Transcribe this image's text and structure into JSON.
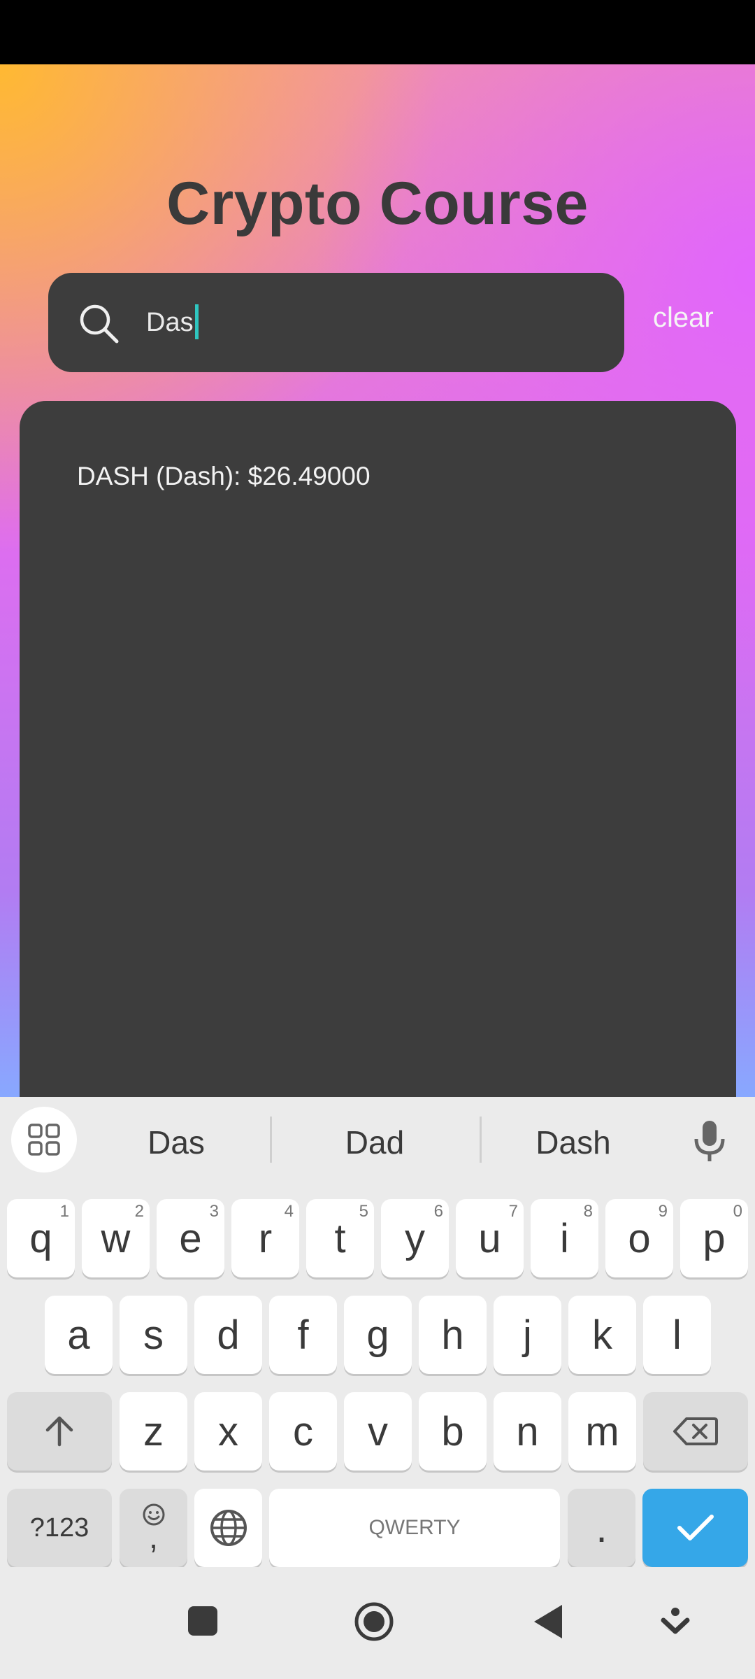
{
  "app": {
    "title": "Crypto Course",
    "search": {
      "value": "Das",
      "clear_label": "clear"
    },
    "results": [
      {
        "text": "DASH (Dash): $26.49000"
      }
    ]
  },
  "keyboard": {
    "suggestions": [
      "Das",
      "Dad",
      "Dash"
    ],
    "row1": [
      {
        "k": "q",
        "h": "1"
      },
      {
        "k": "w",
        "h": "2"
      },
      {
        "k": "e",
        "h": "3"
      },
      {
        "k": "r",
        "h": "4"
      },
      {
        "k": "t",
        "h": "5"
      },
      {
        "k": "y",
        "h": "6"
      },
      {
        "k": "u",
        "h": "7"
      },
      {
        "k": "i",
        "h": "8"
      },
      {
        "k": "o",
        "h": "9"
      },
      {
        "k": "p",
        "h": "0"
      }
    ],
    "row2": [
      "a",
      "s",
      "d",
      "f",
      "g",
      "h",
      "j",
      "k",
      "l"
    ],
    "row3": [
      "z",
      "x",
      "c",
      "v",
      "b",
      "n",
      "m"
    ],
    "symbols_label": "?123",
    "comma_label": ",",
    "space_label": "QWERTY",
    "period_label": "."
  },
  "colors": {
    "enter_key": "#35a7e8",
    "caret": "#2fc6c0",
    "card": "#3d3d3d"
  },
  "icons": [
    "search-icon",
    "apps-grid-icon",
    "microphone-icon",
    "shift-icon",
    "backspace-icon",
    "emoji-icon",
    "globe-icon",
    "checkmark-icon",
    "recents-icon",
    "home-icon",
    "back-icon",
    "hide-keyboard-icon"
  ]
}
